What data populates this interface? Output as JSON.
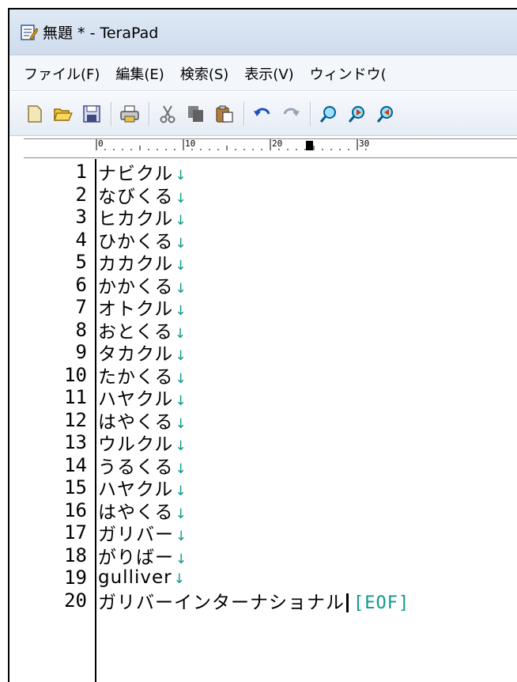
{
  "window": {
    "title": "無題 * - TeraPad"
  },
  "menu": [
    "ファイル(F)",
    "編集(E)",
    "検索(S)",
    "表示(V)",
    "ウィンドウ("
  ],
  "toolbar_icons": [
    "new-file-icon",
    "open-folder-icon",
    "save-disk-icon",
    "print-icon",
    "cut-icon",
    "copy-icon",
    "paste-icon",
    "undo-icon",
    "redo-icon",
    "find-icon",
    "find-next-icon",
    "find-prev-icon"
  ],
  "ruler": {
    "labels": [
      "0",
      "10",
      "20",
      "30"
    ]
  },
  "editor": {
    "eol_mark": "↓",
    "eof_mark": "[EOF]",
    "lines": [
      {
        "num": "1",
        "text": "ナビクル"
      },
      {
        "num": "2",
        "text": "なびくる"
      },
      {
        "num": "3",
        "text": "ヒカクル"
      },
      {
        "num": "4",
        "text": "ひかくる"
      },
      {
        "num": "5",
        "text": "カカクル"
      },
      {
        "num": "6",
        "text": "かかくる"
      },
      {
        "num": "7",
        "text": "オトクル"
      },
      {
        "num": "8",
        "text": "おとくる"
      },
      {
        "num": "9",
        "text": "タカクル"
      },
      {
        "num": "10",
        "text": "たかくる"
      },
      {
        "num": "11",
        "text": "ハヤクル"
      },
      {
        "num": "12",
        "text": "はやくる"
      },
      {
        "num": "13",
        "text": "ウルクル"
      },
      {
        "num": "14",
        "text": "うるくる"
      },
      {
        "num": "15",
        "text": "ハヤクル"
      },
      {
        "num": "16",
        "text": "はやくる"
      },
      {
        "num": "17",
        "text": "ガリバー"
      },
      {
        "num": "18",
        "text": "がりばー"
      },
      {
        "num": "19",
        "text": "gulliver"
      },
      {
        "num": "20",
        "text": "ガリバーインターナショナル"
      }
    ]
  },
  "colors": {
    "eol": "#0a9a8a",
    "titlebar": "#dfe9f5"
  }
}
